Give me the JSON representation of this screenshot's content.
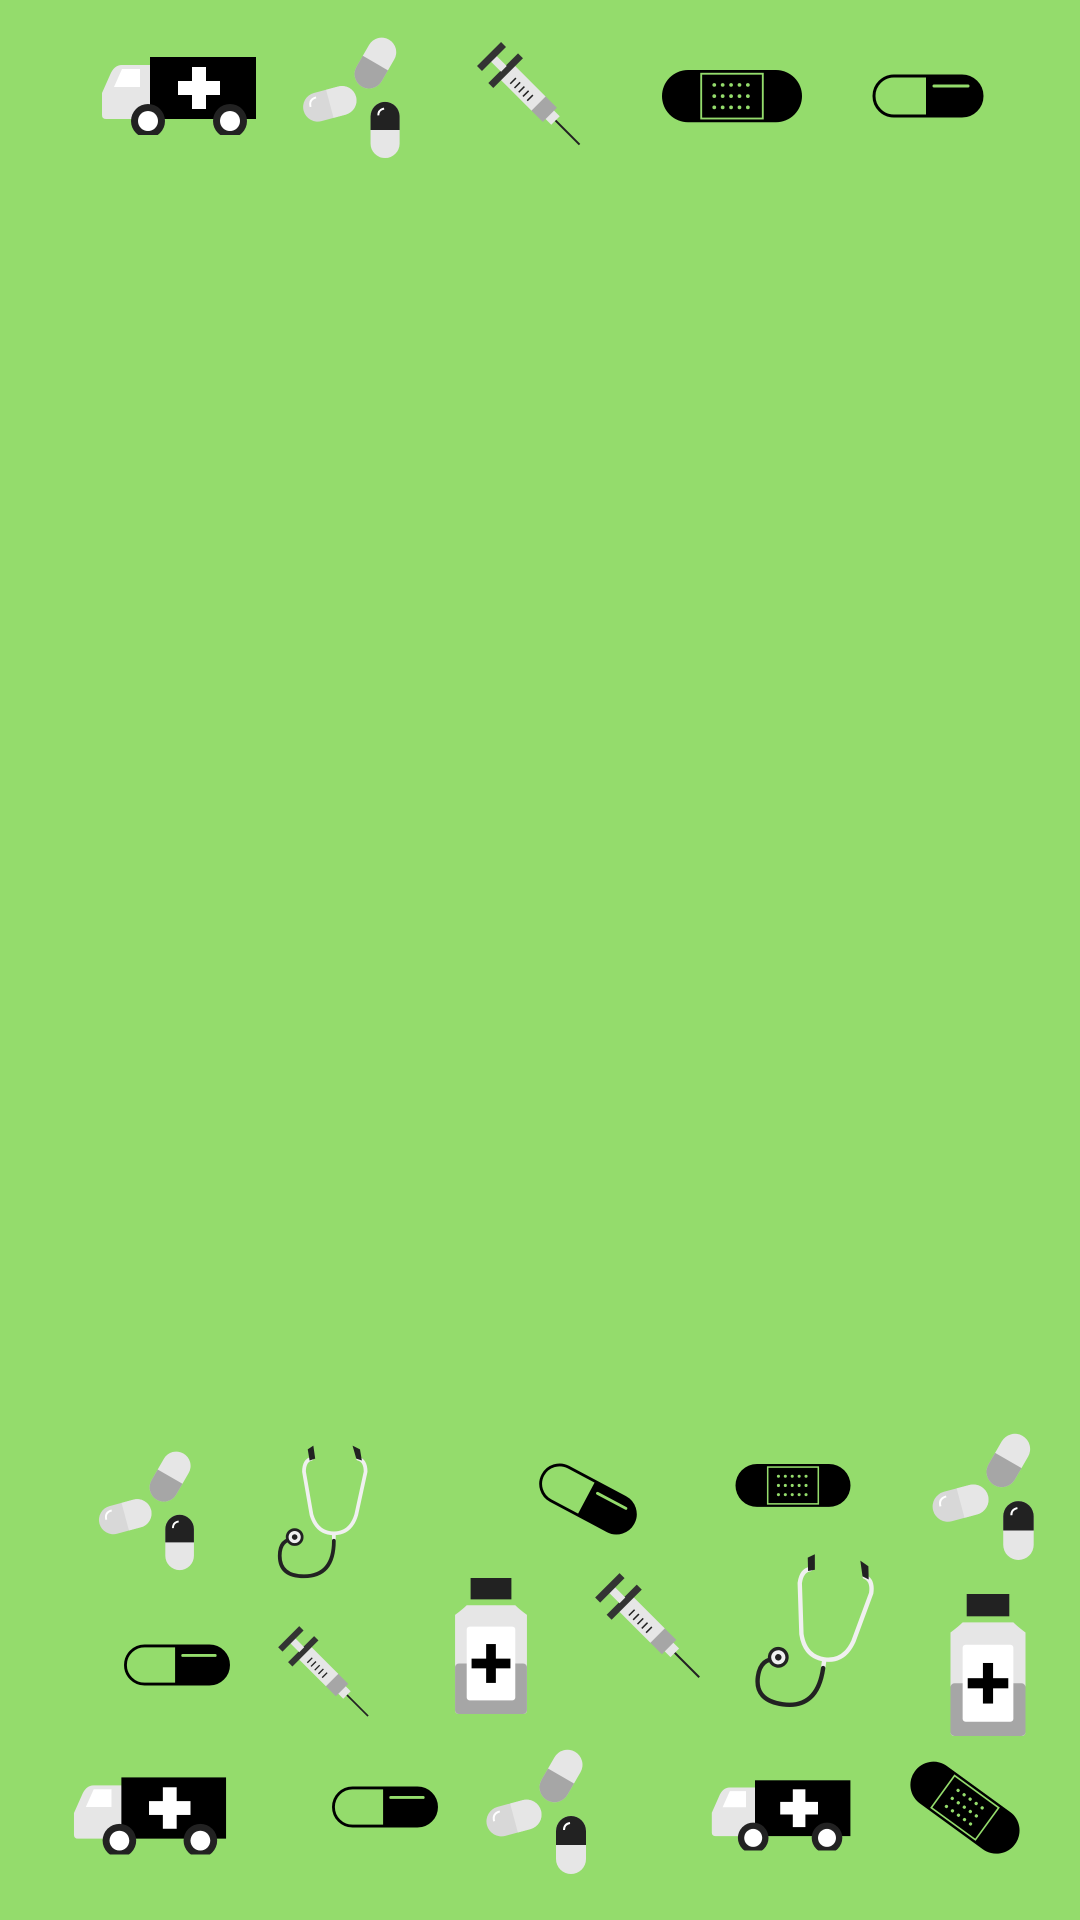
{
  "screen": {
    "type": "wallpaper",
    "pattern": "medical-icons",
    "background_color": "#94dc6c"
  },
  "palette": {
    "black": "#000000",
    "dark": "#222222",
    "white": "#ffffff",
    "light_gray": "#e6e6e6",
    "mid_gray": "#a6a6a6",
    "accent_green": "#94dc6c"
  },
  "icons": {
    "top_row": [
      "ambulance-icon",
      "pills-icon",
      "syringe-icon",
      "bandage-icon",
      "capsule-icon"
    ],
    "lower_row_1": [
      "pills-icon",
      "stethoscope-icon",
      "capsule-icon",
      "bandage-icon",
      "pills-icon"
    ],
    "lower_row_2": [
      "capsule-icon",
      "syringe-icon",
      "medicine-bottle-icon",
      "syringe-icon",
      "stethoscope-icon",
      "medicine-bottle-icon"
    ],
    "lower_row_3": [
      "ambulance-icon",
      "capsule-icon",
      "pills-icon",
      "ambulance-icon",
      "bandage-icon"
    ]
  }
}
